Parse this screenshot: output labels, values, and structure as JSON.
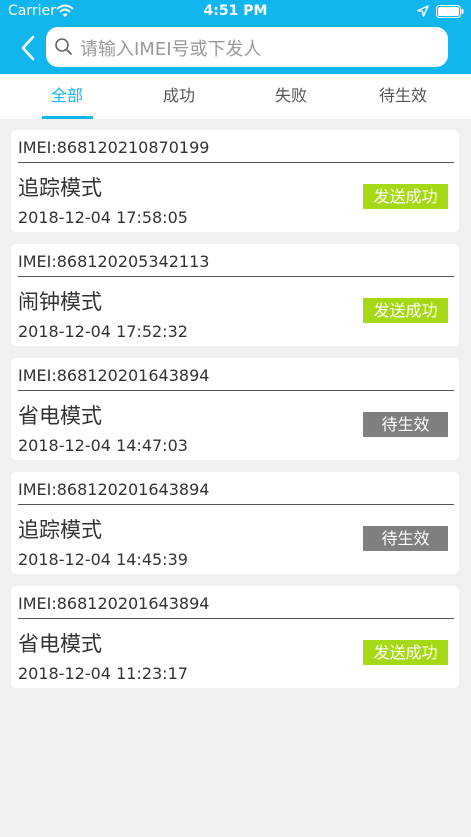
{
  "status_bar": {
    "carrier": "Carrier",
    "time": "4:51 PM"
  },
  "search": {
    "placeholder": "请输入IMEI号或下发人"
  },
  "tabs": [
    {
      "label": "全部",
      "active": true
    },
    {
      "label": "成功",
      "active": false
    },
    {
      "label": "失败",
      "active": false
    },
    {
      "label": "待生效",
      "active": false
    }
  ],
  "colors": {
    "accent": "#11b6ee",
    "success": "#a5d916",
    "pending": "#7f7f7f"
  },
  "records": [
    {
      "imei": "IMEI:868120210870199",
      "mode": "追踪模式",
      "time": "2018-12-04 17:58:05",
      "status": "发送成功",
      "status_type": "success"
    },
    {
      "imei": "IMEI:868120205342113",
      "mode": "闹钟模式",
      "time": "2018-12-04 17:52:32",
      "status": "发送成功",
      "status_type": "success"
    },
    {
      "imei": "IMEI:868120201643894",
      "mode": "省电模式",
      "time": "2018-12-04 14:47:03",
      "status": "待生效",
      "status_type": "pending"
    },
    {
      "imei": "IMEI:868120201643894",
      "mode": "追踪模式",
      "time": "2018-12-04 14:45:39",
      "status": "待生效",
      "status_type": "pending"
    },
    {
      "imei": "IMEI:868120201643894",
      "mode": "省电模式",
      "time": "2018-12-04 11:23:17",
      "status": "发送成功",
      "status_type": "success"
    }
  ]
}
